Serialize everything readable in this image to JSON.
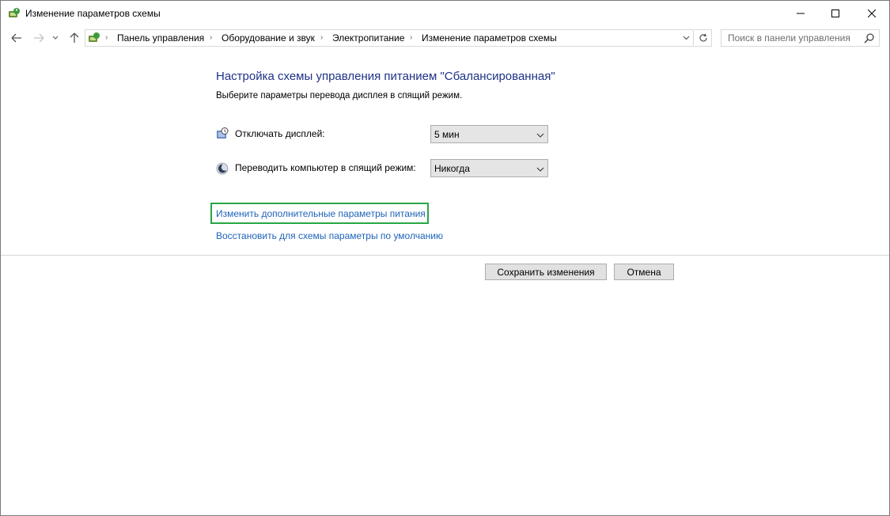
{
  "window": {
    "title": "Изменение параметров схемы"
  },
  "navigation": {
    "breadcrumbs": [
      "Панель управления",
      "Оборудование и звук",
      "Электропитание",
      "Изменение параметров схемы"
    ],
    "search_placeholder": "Поиск в панели управления"
  },
  "content": {
    "heading": "Настройка схемы управления питанием \"Сбалансированная\"",
    "subheading": "Выберите параметры перевода дисплея в спящий режим.",
    "settings": [
      {
        "label": "Отключать дисплей:",
        "value": "5 мин",
        "icon": "monitor-timer-icon"
      },
      {
        "label": "Переводить компьютер в спящий режим:",
        "value": "Никогда",
        "icon": "sleep-moon-icon"
      }
    ],
    "links": {
      "advanced": "Изменить дополнительные параметры питания",
      "restore": "Восстановить для схемы параметры по умолчанию"
    }
  },
  "buttons": {
    "save": "Сохранить изменения",
    "cancel": "Отмена"
  },
  "colors": {
    "heading": "#1e3287",
    "link": "#1e63b8",
    "highlight": "#28a745"
  }
}
